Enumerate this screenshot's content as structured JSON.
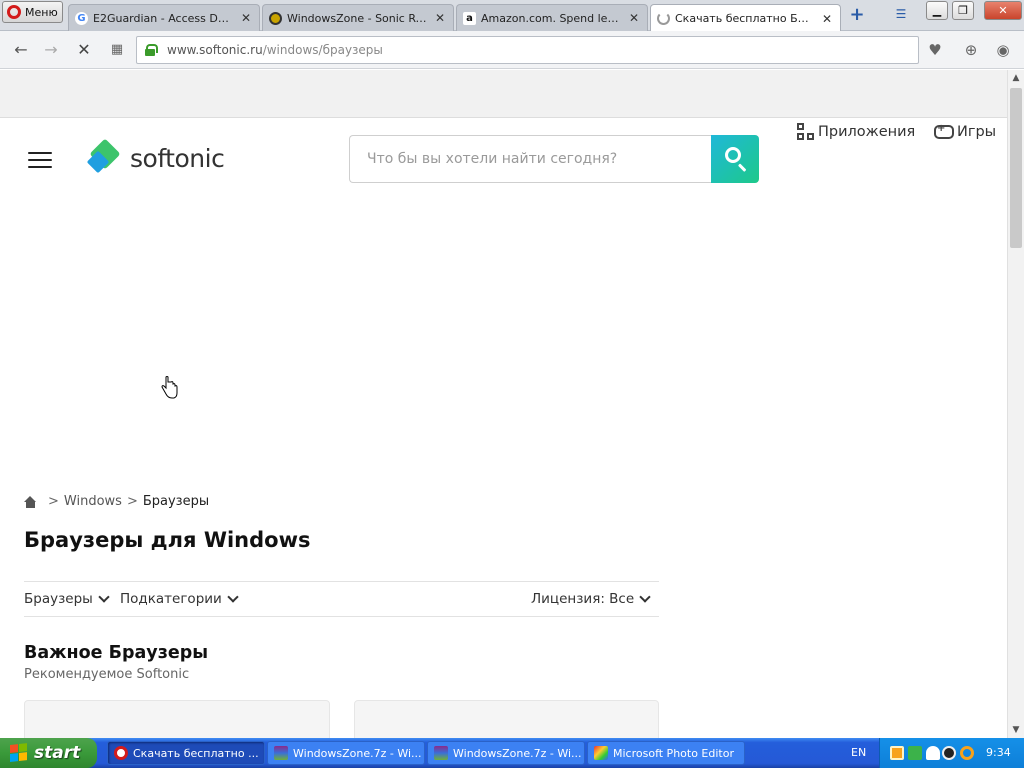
{
  "browser": {
    "menu_label": "Меню",
    "tabs": [
      {
        "title": "E2Guardian - Access Denied",
        "icon": "google-g-icon"
      },
      {
        "title": "WindowsZone - Sonic Retro",
        "icon": "sonic-retro-icon"
      },
      {
        "title": "Amazon.com. Spend less. Smile more.",
        "icon": "amazon-icon"
      },
      {
        "title": "Скачать бесплатно Браузеры",
        "icon": "loading-spinner-icon",
        "active": true
      }
    ],
    "address": {
      "host": "www.softonic.ru",
      "path": "/windows/браузеры"
    }
  },
  "site": {
    "logo_text": "softonic",
    "search_placeholder": "Что бы вы хотели найти сегодня?",
    "nav": {
      "apps": "Приложения",
      "games": "Игры"
    },
    "breadcrumb": {
      "sep": ">",
      "windows": "Windows",
      "current": "Браузеры"
    },
    "page_title": "Браузеры для Windows",
    "filters": {
      "category": "Браузеры",
      "subcategories": "Подкатегории",
      "license": "Лицензия: Все"
    },
    "section": {
      "title": "Важное Браузеры",
      "subtitle": "Рекомендуемое Softonic"
    },
    "colors": {
      "accent_start": "#1fb8d8",
      "accent_end": "#1ec98a"
    }
  },
  "taskbar": {
    "start_label": "start",
    "tasks": [
      {
        "label": "Скачать бесплатно ..."
      },
      {
        "label": "WindowsZone.7z - Wi..."
      },
      {
        "label": "WindowsZone.7z - Wi..."
      },
      {
        "label": "Microsoft Photo Editor"
      }
    ],
    "lang": "EN",
    "clock": "9:34"
  }
}
